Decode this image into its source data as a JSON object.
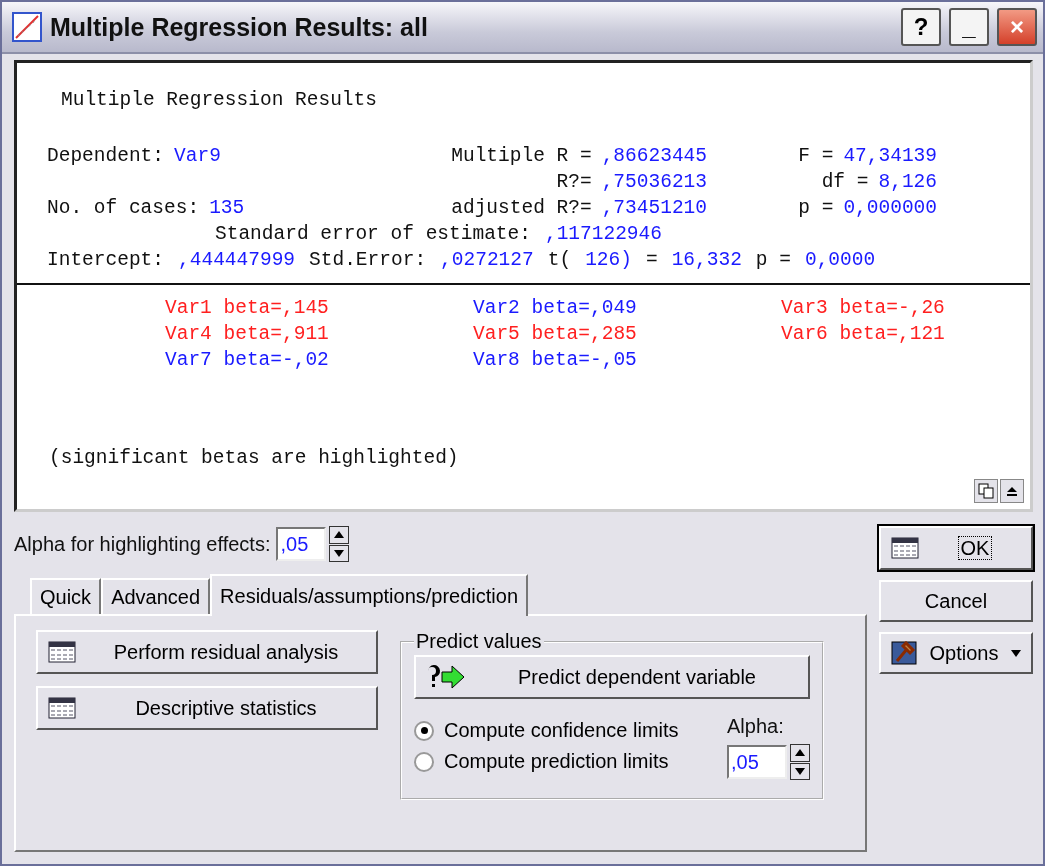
{
  "window": {
    "title": "Multiple Regression Results: all",
    "buttons": [
      "?",
      "_",
      "×"
    ]
  },
  "report": {
    "title": "Multiple Regression Results",
    "rows": [
      {
        "kind": "grid",
        "left": {
          "label": "Dependent:",
          "value": "Var9"
        },
        "middle": {
          "label": "Multiple R =",
          "value": ",86623445"
        },
        "right": {
          "label": "F =",
          "value": "47,34139"
        }
      },
      {
        "kind": "grid",
        "middle": {
          "label": "R?=",
          "value": ",75036213"
        },
        "right": {
          "label": "df =",
          "value": "8,126"
        }
      },
      {
        "kind": "grid",
        "left": {
          "label": "No. of cases:",
          "value": "135"
        },
        "middle": {
          "label": "adjusted R?=",
          "value": ",73451210"
        },
        "right": {
          "label": "p =",
          "value": "0,000000"
        }
      },
      {
        "kind": "indented",
        "segments": [
          {
            "kind": "label",
            "text": "Standard error of estimate:"
          },
          {
            "kind": "value",
            "text": ",117122946"
          }
        ]
      },
      {
        "kind": "line",
        "segments": [
          {
            "kind": "label",
            "text": "Intercept:"
          },
          {
            "kind": "value",
            "text": ",444447999"
          },
          {
            "kind": "label",
            "text": "Std.Error:"
          },
          {
            "kind": "value",
            "text": ",0272127"
          },
          {
            "kind": "label",
            "text": "t("
          },
          {
            "kind": "value",
            "text": "126)"
          },
          {
            "kind": "label",
            "text": "="
          },
          {
            "kind": "value",
            "text": "16,332"
          },
          {
            "kind": "label",
            "text": "p ="
          },
          {
            "kind": "value",
            "text": "0,0000"
          }
        ]
      }
    ],
    "betas": [
      {
        "text": "Var1 beta=,145",
        "significant": true
      },
      {
        "text": "Var2 beta=,049",
        "significant": false
      },
      {
        "text": "Var3 beta=-,26",
        "significant": true
      },
      {
        "text": "Var4 beta=,911",
        "significant": true
      },
      {
        "text": "Var5 beta=,285",
        "significant": true
      },
      {
        "text": "Var6 beta=,121",
        "significant": true
      },
      {
        "text": "Var7 beta=-,02",
        "significant": false
      },
      {
        "text": "Var8 beta=-,05",
        "significant": false
      }
    ],
    "note": "(significant betas are highlighted)"
  },
  "alpha": {
    "label": "Alpha for highlighting effects:",
    "value": ",05"
  },
  "tabs": [
    {
      "label": "Quick",
      "selected": false
    },
    {
      "label": "Advanced",
      "selected": false
    },
    {
      "label": "Residuals/assumptions/prediction",
      "selected": true
    }
  ],
  "left_buttons": [
    "Perform residual analysis",
    "Descriptive statistics"
  ],
  "predict": {
    "title": "Predict values",
    "button": "Predict dependent variable",
    "options": [
      {
        "label": "Compute confidence limits",
        "selected": true
      },
      {
        "label": "Compute prediction limits",
        "selected": false
      }
    ],
    "alpha_label": "Alpha:",
    "alpha_value": ",05"
  },
  "side_buttons": [
    {
      "kind": "ok",
      "label": "OK"
    },
    {
      "kind": "cancel",
      "label": "Cancel"
    },
    {
      "kind": "options",
      "label": "Options"
    }
  ]
}
